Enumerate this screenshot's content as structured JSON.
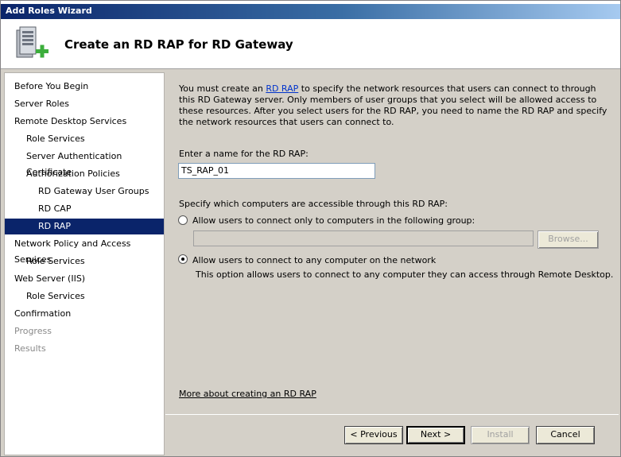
{
  "window": {
    "title": "Add Roles Wizard"
  },
  "header": {
    "title": "Create an RD RAP for RD Gateway",
    "icon": "server-add-icon"
  },
  "sidebar": {
    "items": [
      {
        "label": "Before You Begin",
        "level": 0,
        "state": "normal"
      },
      {
        "label": "Server Roles",
        "level": 0,
        "state": "normal"
      },
      {
        "label": "Remote Desktop Services",
        "level": 0,
        "state": "normal"
      },
      {
        "label": "Role Services",
        "level": 1,
        "state": "normal"
      },
      {
        "label": "Server Authentication Certificate",
        "level": 1,
        "state": "normal"
      },
      {
        "label": "Authorization Policies",
        "level": 1,
        "state": "normal"
      },
      {
        "label": "RD Gateway User Groups",
        "level": 2,
        "state": "normal"
      },
      {
        "label": "RD CAP",
        "level": 2,
        "state": "normal"
      },
      {
        "label": "RD RAP",
        "level": 2,
        "state": "selected"
      },
      {
        "label": "Network Policy and Access Services",
        "level": 0,
        "state": "normal"
      },
      {
        "label": "Role Services",
        "level": 1,
        "state": "normal"
      },
      {
        "label": "Web Server (IIS)",
        "level": 0,
        "state": "normal"
      },
      {
        "label": "Role Services",
        "level": 1,
        "state": "normal"
      },
      {
        "label": "Confirmation",
        "level": 0,
        "state": "normal"
      },
      {
        "label": "Progress",
        "level": 0,
        "state": "disabled"
      },
      {
        "label": "Results",
        "level": 0,
        "state": "disabled"
      }
    ]
  },
  "main": {
    "intro_before": "You must create an ",
    "intro_link": "RD RAP",
    "intro_after": " to specify the network resources that users can connect to through this RD Gateway server. Only members of user groups that you select will be allowed access to these resources. After you select users for the RD RAP, you need to name the RD RAP and specify the network resources that users can connect to.",
    "name_label": "Enter a name for the RD RAP:",
    "name_value": "TS_RAP_01",
    "computers_label": "Specify which computers are accessible through this RD RAP:",
    "option_group_label": "Allow users to connect only to computers in the following group:",
    "group_value": "",
    "browse_label": "Browse...",
    "option_any_label": "Allow users to connect to any computer on the network",
    "option_any_desc": "This option allows users to connect to any computer they can access through Remote Desktop.",
    "selected_option": "any",
    "more_link": "More about creating an RD RAP"
  },
  "footer": {
    "previous": "< Previous",
    "next": "Next >",
    "install": "Install",
    "cancel": "Cancel"
  }
}
